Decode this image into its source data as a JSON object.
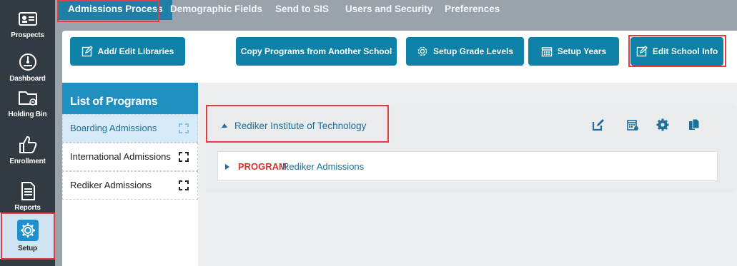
{
  "sidebar": {
    "items": [
      {
        "label": "Prospects",
        "icon": "id-card-icon"
      },
      {
        "label": "Dashboard",
        "icon": "gauge-icon"
      },
      {
        "label": "Holding Bin",
        "icon": "folder-icon"
      },
      {
        "label": "Enrollment",
        "icon": "thumbs-up-icon"
      },
      {
        "label": "Reports",
        "icon": "document-icon"
      },
      {
        "label": "Setup",
        "icon": "gear-icon"
      }
    ],
    "active": "Setup"
  },
  "tabs": [
    {
      "label": "Admissions Process"
    },
    {
      "label": "Demographic Fields"
    },
    {
      "label": "Send to SIS"
    },
    {
      "label": "Users and Security"
    },
    {
      "label": "Preferences"
    }
  ],
  "toolbar": {
    "add_edit_libraries": "Add/ Edit Libraries",
    "copy_programs": "Copy Programs from Another School",
    "setup_grade_levels": "Setup Grade Levels",
    "setup_years": "Setup Years",
    "edit_school_info": "Edit School Info"
  },
  "program_list": {
    "title": "List of Programs",
    "items": [
      {
        "label": "Boarding Admissions"
      },
      {
        "label": "International Admissions"
      },
      {
        "label": "Rediker Admissions"
      }
    ]
  },
  "school": {
    "name": "Rediker Institute of Technology",
    "program_keyword": "PROGRAM",
    "program_name": "Rediker Admissions"
  },
  "colors": {
    "accent": "#0e82a6",
    "highlight": "#e53d3d",
    "sidebar": "#323a42",
    "program_keyword": "#d9322c"
  }
}
